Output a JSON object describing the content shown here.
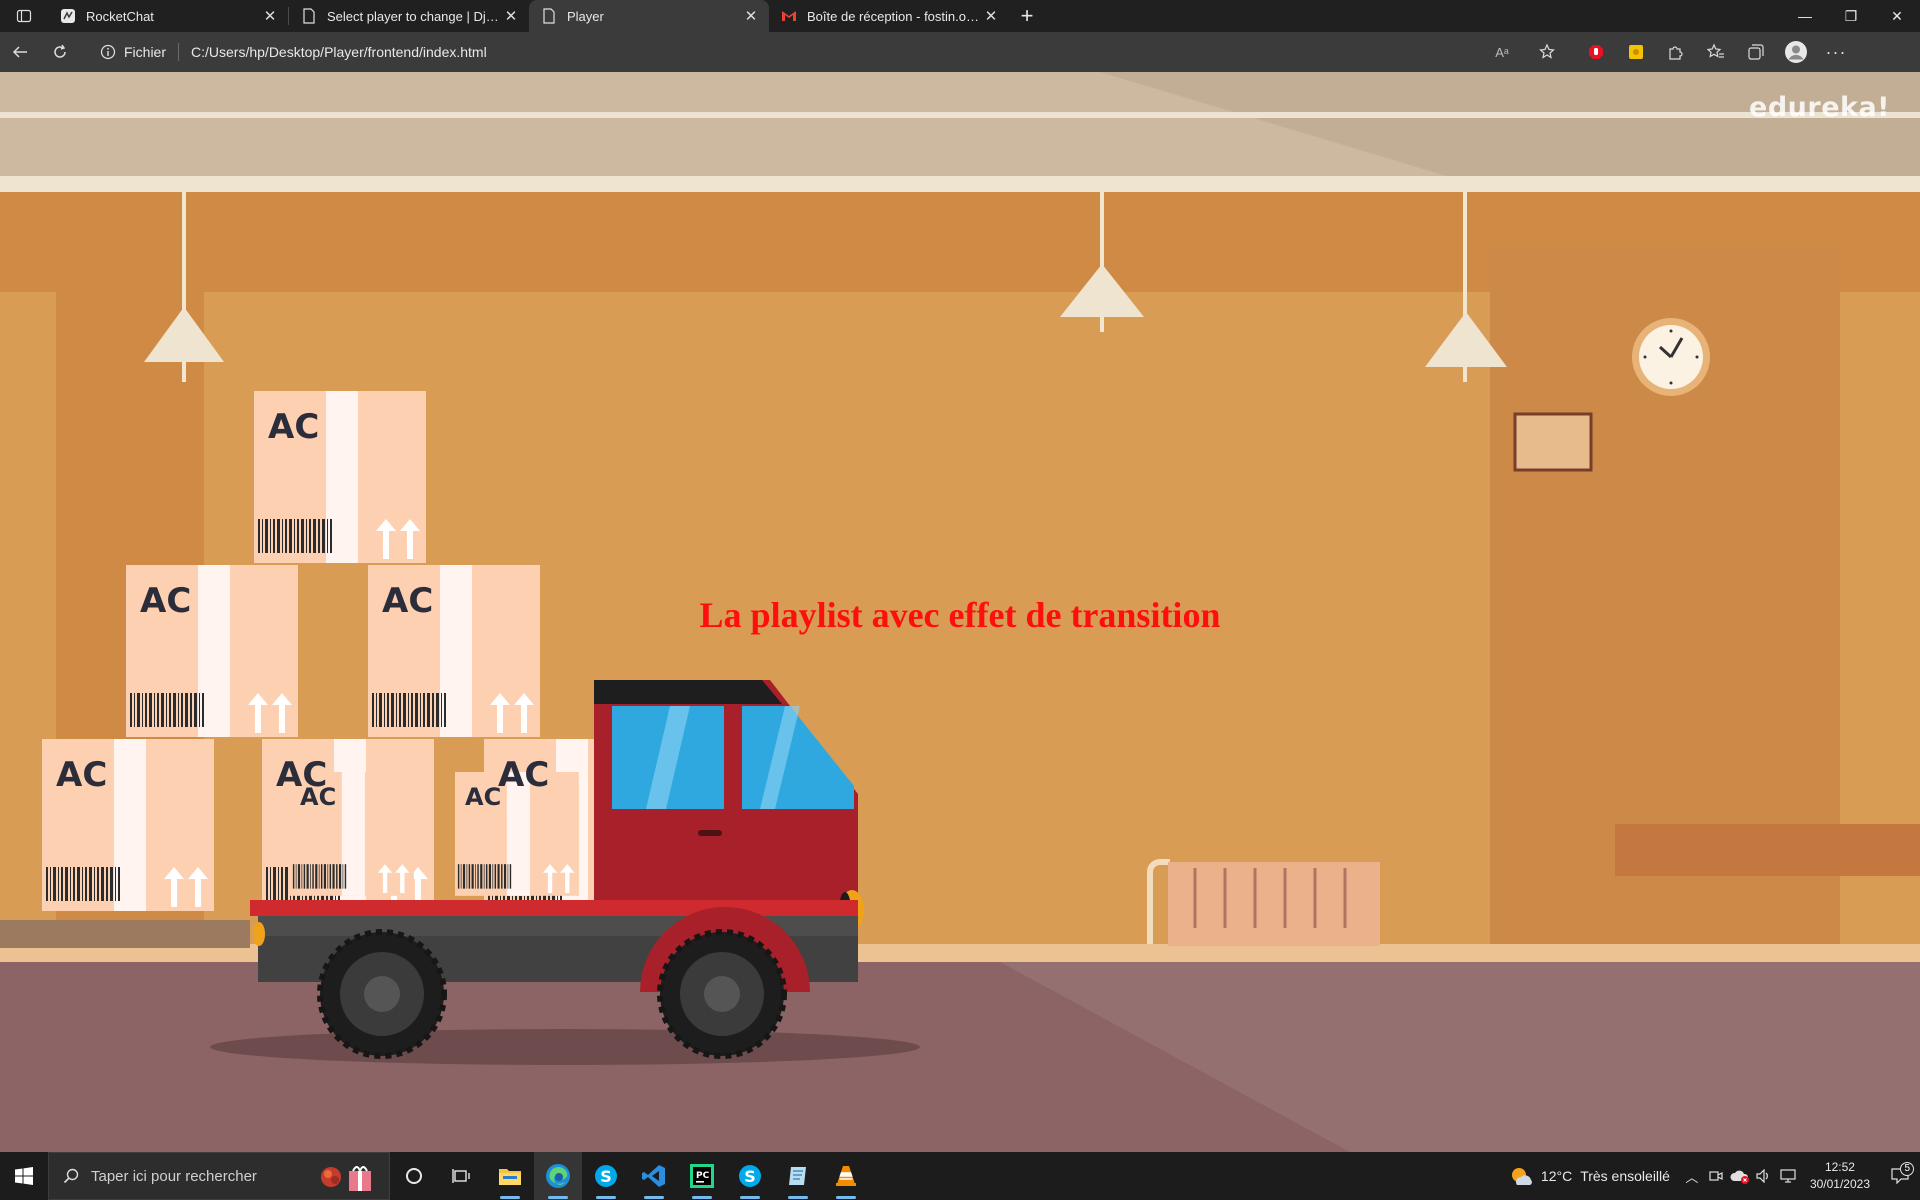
{
  "browser": {
    "tabs": [
      {
        "title": "RocketChat",
        "favicon": "rocketchat-icon",
        "active": false
      },
      {
        "title": "Select player to change | Django",
        "favicon": "page-icon",
        "active": false
      },
      {
        "title": "Player",
        "favicon": "page-icon",
        "active": true
      },
      {
        "title": "Boîte de réception - fostin.opens",
        "favicon": "gmail-icon",
        "active": false
      }
    ],
    "site_info_label": "Fichier",
    "url": "C:/Users/hp/Desktop/Player/frontend/index.html"
  },
  "page": {
    "heading": "La playlist avec effet de transition",
    "watermark": "edureka!",
    "box_label": "AC",
    "heading_color": "#ff0e0e"
  },
  "taskbar": {
    "search_placeholder": "Taper ici pour rechercher",
    "apps": [
      "cortana-icon",
      "task-view-icon",
      "file-explorer-icon",
      "edge-icon",
      "skype-icon",
      "vscode-icon",
      "pycharm-icon",
      "skype-icon",
      "notepad-icon",
      "vlc-icon"
    ],
    "weather": {
      "temp": "12°C",
      "condition": "Très ensoleillé"
    },
    "time": "12:52",
    "date": "30/01/2023",
    "notification_count": "5"
  }
}
